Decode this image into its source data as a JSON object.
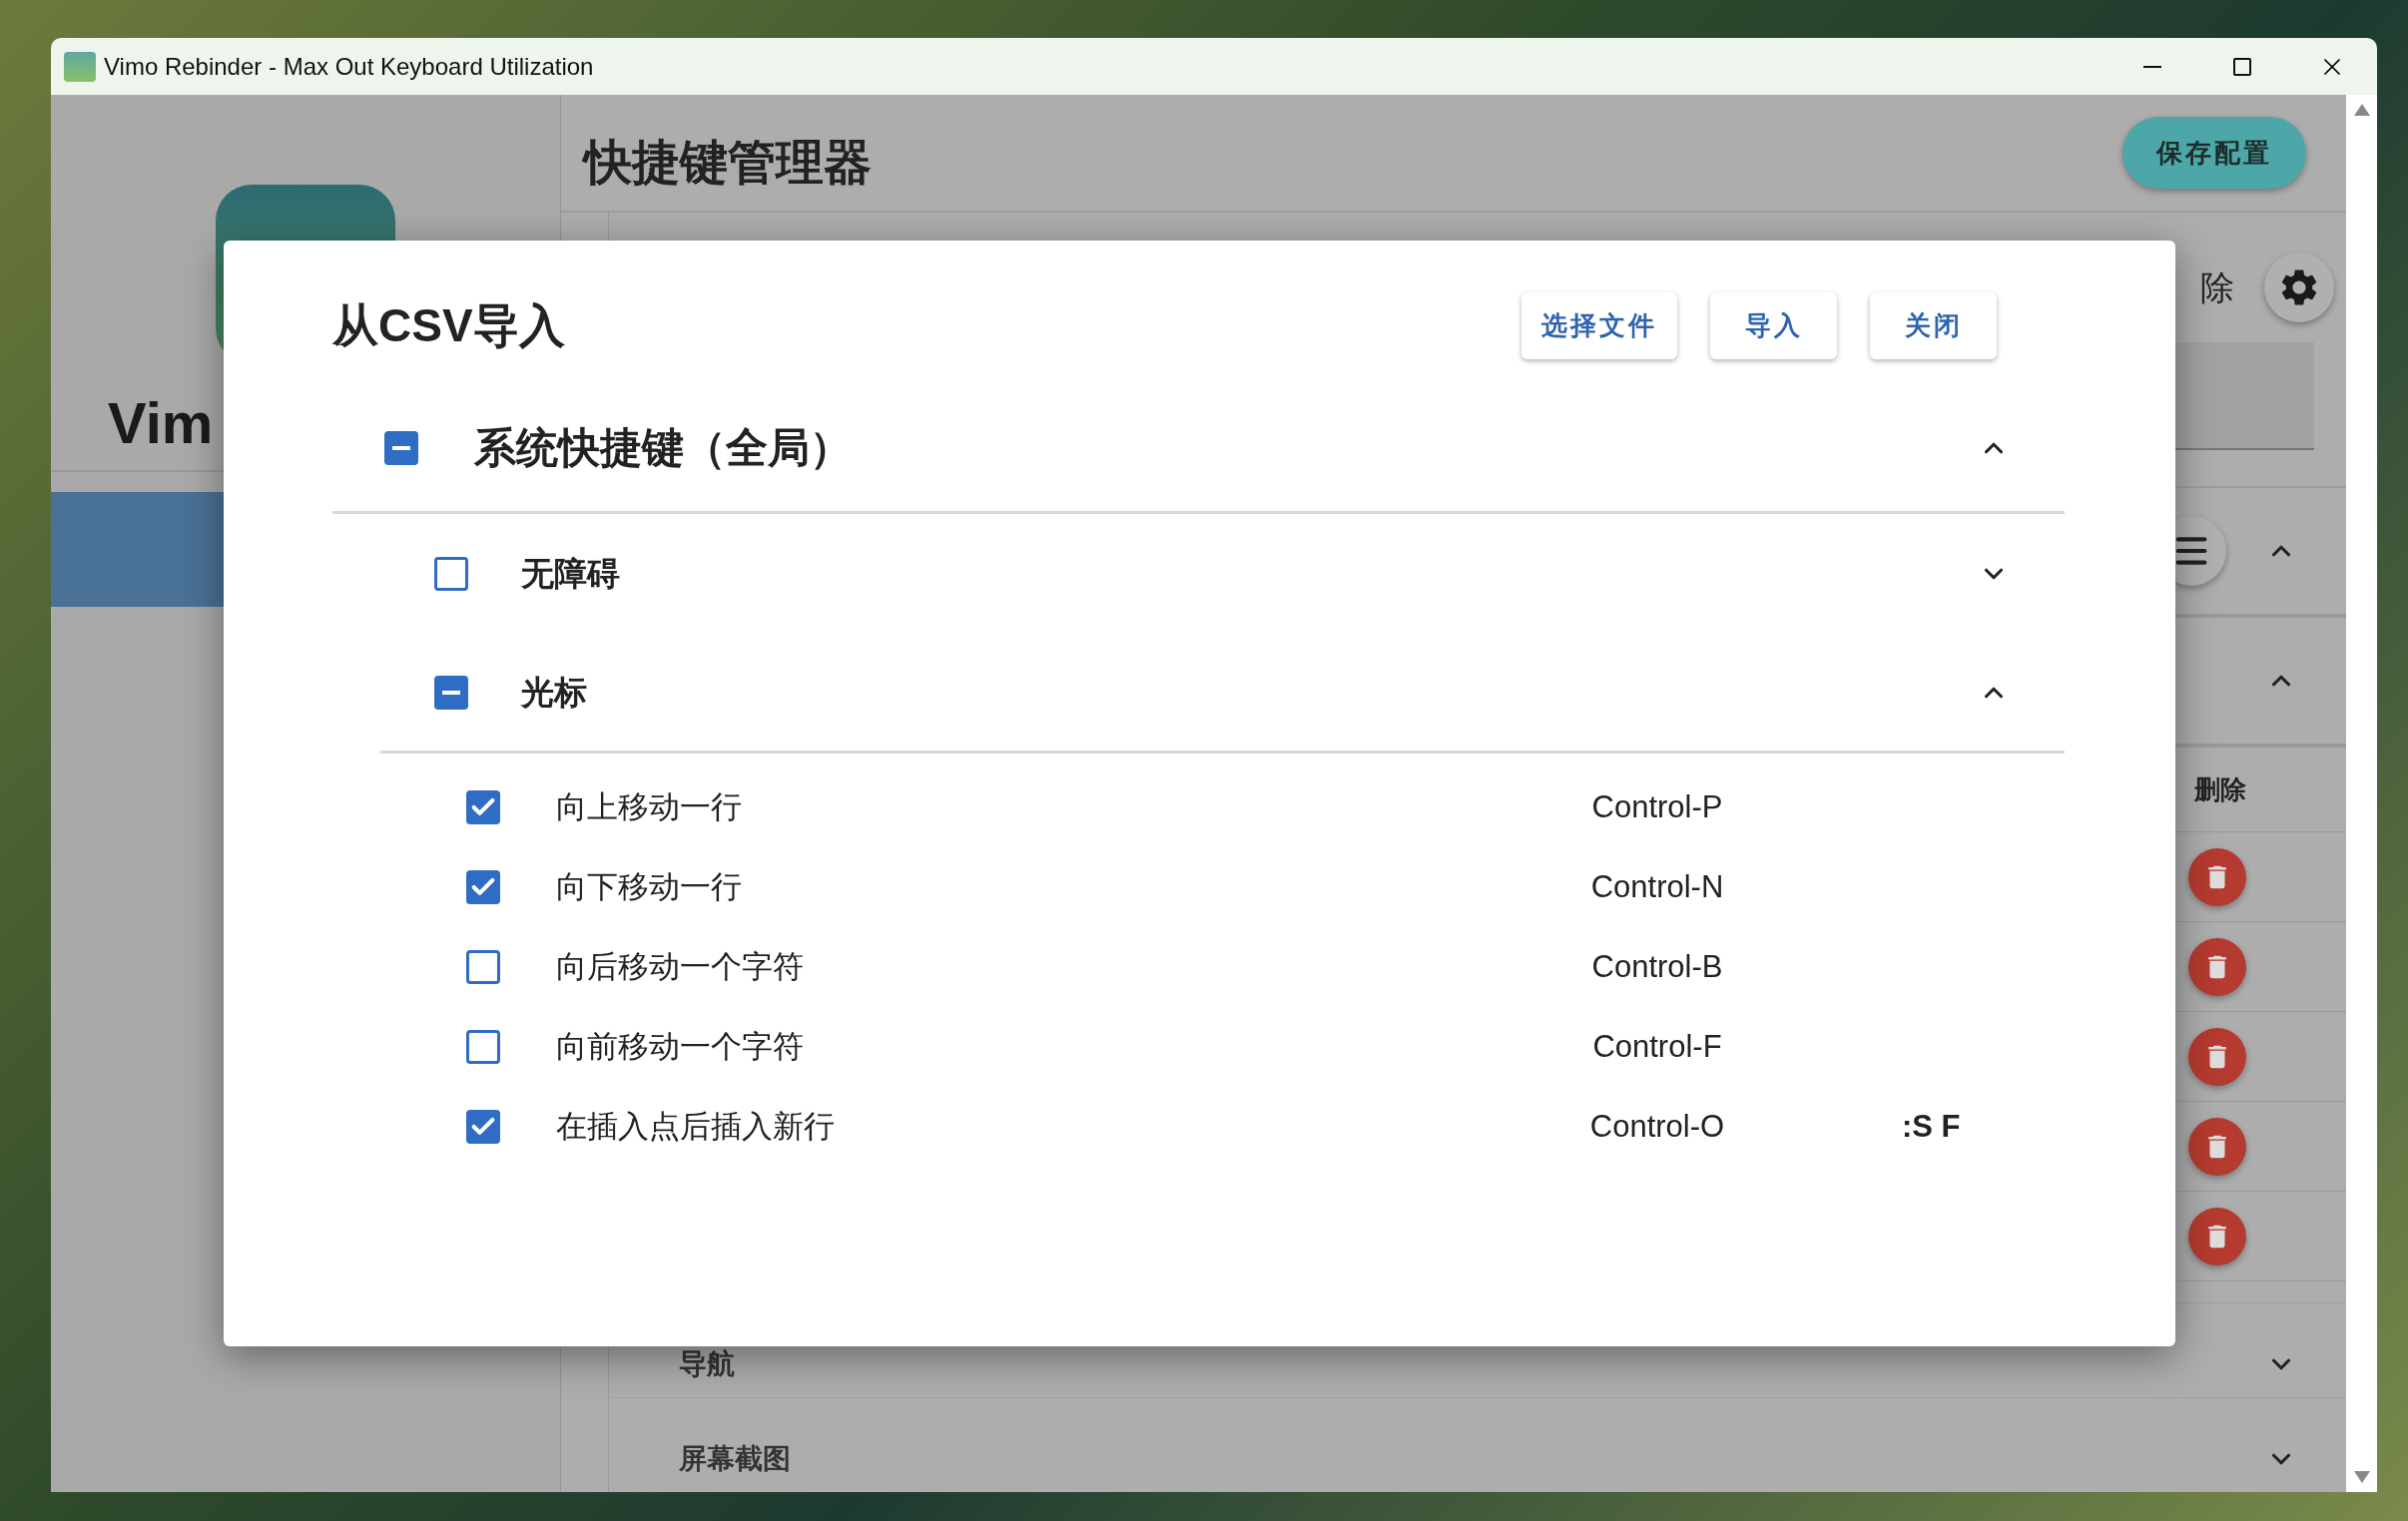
{
  "window": {
    "title": "Vimo Rebinder - Max Out Keyboard Utilization"
  },
  "sidebar": {
    "app_name": "Vim"
  },
  "header": {
    "title": "快捷键管理器",
    "save_button": "保存配置"
  },
  "background": {
    "delete_label": "除",
    "column_header": "删除",
    "categories": [
      {
        "label": "导航",
        "expanded": false
      },
      {
        "label": "屏幕截图",
        "expanded": false
      }
    ]
  },
  "dialog": {
    "title": "从CSV导入",
    "buttons": [
      "选择文件",
      "导入",
      "关闭"
    ],
    "tree": [
      {
        "label": "系统快捷键（全局）",
        "indeterminate": true,
        "expanded": true,
        "children": [
          {
            "label": "无障碍",
            "checked": false,
            "indeterminate": false,
            "expanded": false
          },
          {
            "label": "光标",
            "indeterminate": true,
            "expanded": true,
            "children": [
              {
                "label": "向上移动一行",
                "checked": true,
                "shortcut": "Control-P"
              },
              {
                "label": "向下移动一行",
                "checked": true,
                "shortcut": "Control-N"
              },
              {
                "label": "向后移动一个字符",
                "checked": false,
                "shortcut": "Control-B"
              },
              {
                "label": "向前移动一个字符",
                "checked": false,
                "shortcut": "Control-F"
              },
              {
                "label": "在插入点后插入新行",
                "checked": true,
                "shortcut": "Control-O",
                "extra": ":S F"
              }
            ]
          }
        ]
      }
    ]
  }
}
